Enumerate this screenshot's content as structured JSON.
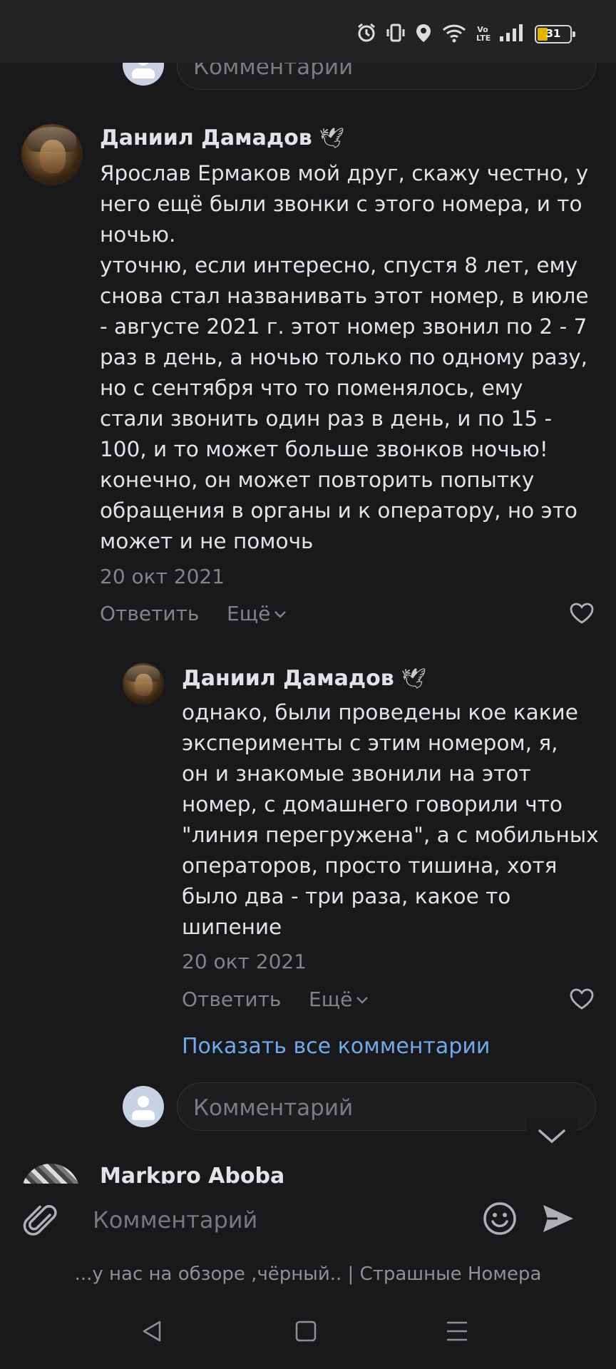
{
  "status_bar": {
    "battery": "31",
    "icons": [
      "alarm-icon",
      "vibrate-icon",
      "location-icon",
      "wifi-icon",
      "volte-icon",
      "signal-icon",
      "battery-icon"
    ],
    "volte": "Vo LTE"
  },
  "top_input": {
    "placeholder": "Комментарий"
  },
  "comment1": {
    "author": "Даниил Дамадов",
    "badge": "🕊",
    "text": "Ярослав Ермаков мой друг, скажу честно, у\nнего ещё были звонки с этого номера, и то\nночью.\nуточню, если интересно, спустя 8 лет, ему\nснова стал названивать этот номер, в июле\n- августе 2021 г. этот номер звонил по 2 - 7\nраз в день, а ночью только по одному разу,\nно с сентября что то поменялось, ему\nстали звонить один раз в день, и по 15 -\n100, и то может больше звонков ночью!\nконечно, он может повторить попытку\nобращения в органы и к оператору, но это\nможет и не помочь",
    "date": "20 окт 2021",
    "reply": "Ответить",
    "more": "Ещё"
  },
  "comment2": {
    "author": "Даниил Дамадов",
    "badge": "🕊",
    "text": "однако, были проведены кое какие\nэксперименты с этим номером, я,\nон и знакомые звонили на этот\nномер, с домашнего говорили что\n\"линия перегружена\", а с мобильных\nоператоров, просто тишина, хотя\nбыло два - три раза, какое то\nшипение",
    "date": "20 окт 2021",
    "reply": "Ответить",
    "more": "Ещё"
  },
  "show_all": "Показать все комментарии",
  "reply_input": {
    "placeholder": "Комментарий"
  },
  "next_comment": {
    "author": "Markpro Aboba"
  },
  "composer": {
    "placeholder": "Комментарий",
    "caption": "...у нас на обзоре ,чёрный.. | Страшные Номера"
  },
  "colors": {
    "background": "#19191b",
    "link": "#71aaeb",
    "secondary_text": "#818389"
  }
}
